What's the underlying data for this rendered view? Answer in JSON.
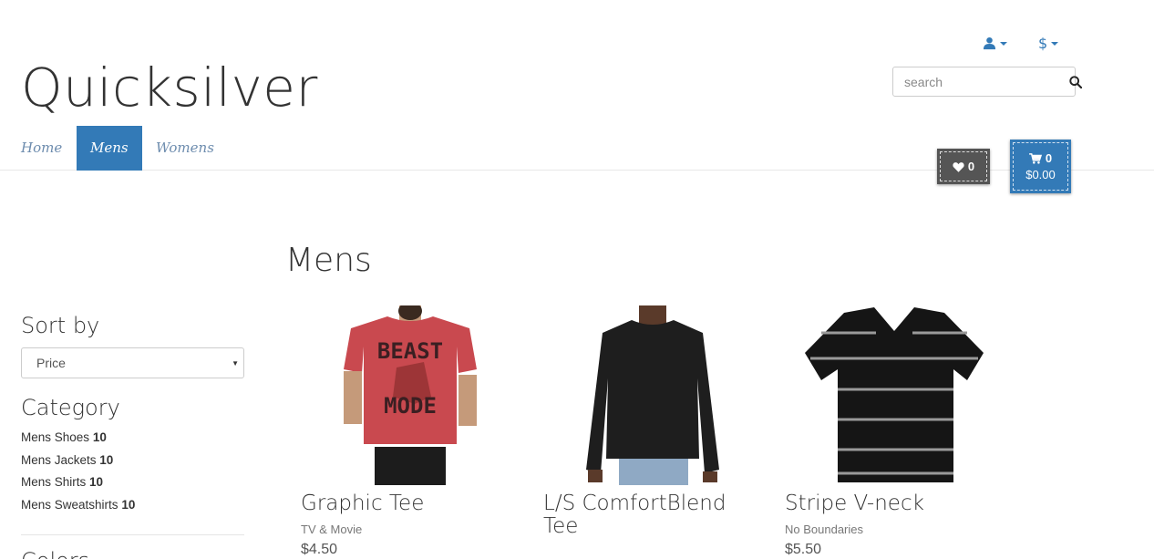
{
  "header": {
    "brand": "Quicksilver",
    "account_icon": "user-icon",
    "currency_symbol": "$",
    "search_placeholder": "search"
  },
  "nav": {
    "items": [
      {
        "label": "Home",
        "active": false
      },
      {
        "label": "Mens",
        "active": true
      },
      {
        "label": "Womens",
        "active": false
      }
    ]
  },
  "wishlist": {
    "count": "0"
  },
  "cart": {
    "count": "0",
    "total": "$0.00"
  },
  "page": {
    "title": "Mens"
  },
  "sidebar": {
    "sort_heading": "Sort by",
    "sort_value": "Price",
    "category_heading": "Category",
    "categories": [
      {
        "label": "Mens Shoes",
        "count": "10"
      },
      {
        "label": "Mens Jackets",
        "count": "10"
      },
      {
        "label": "Mens Shirts",
        "count": "10"
      },
      {
        "label": "Mens Sweatshirts",
        "count": "10"
      }
    ],
    "next_heading": "Colors"
  },
  "products": [
    {
      "name": "Graphic Tee",
      "brand": "TV & Movie",
      "price": "$4.50",
      "image_text_1": "BEAST",
      "image_text_2": "MODE"
    },
    {
      "name": "L/S ComfortBlend Tee",
      "brand": "",
      "price": ""
    },
    {
      "name": "Stripe V-neck",
      "brand": "No Boundaries",
      "price": "$5.50"
    }
  ],
  "colors": {
    "accent": "#337ab7",
    "wishlist_bg": "#555555",
    "nav_link": "#6d8cae"
  }
}
